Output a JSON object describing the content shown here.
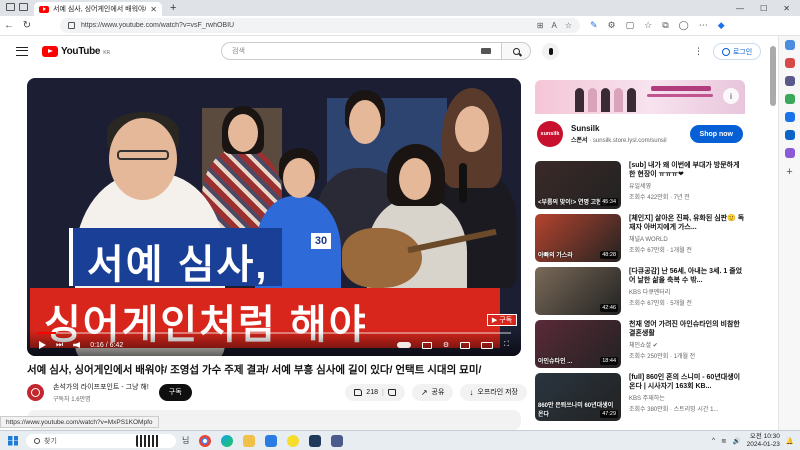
{
  "browser": {
    "tab_title": "서예 심사, 싱어게인에서 배워야/ 조",
    "url": "https://www.youtube.com/watch?v=vsF_rwhOBIU",
    "status_url": "https://www.youtube.com/watch?v=MxPS1KOMpfo"
  },
  "yt": {
    "logo_text": "YouTube",
    "logo_region": "KR",
    "search_placeholder": "검색",
    "login_label": "로그인"
  },
  "video": {
    "caption_line1": "서예 심사,",
    "caption_line2": "싱어게인처럼 해야",
    "badge_label": "구독",
    "time": "0:16 / 6:42",
    "progress_fraction": 0.04,
    "jersey_number": "30"
  },
  "meta": {
    "title": "서예 심사, 싱어게인에서 배워야/ 조영섭 가수 주제 결과/ 서예 부흥 심사에 길이 있다/ 언택트 시대의 묘미/",
    "channel_name": "손석가의 라이프포인트 - 그냥 해!",
    "subscribers": "구독자 1.6만명",
    "subscribe_label": "구독",
    "likes": "218",
    "share_label": "공유",
    "offline_label": "오프라인 저장"
  },
  "ad": {
    "name": "Sunsilk",
    "sponsor": "스폰서",
    "domain": "sunsilk.store.lysl.com/sunsil",
    "cta": "Shop now",
    "logo_text": "sunsilk",
    "info_icon": "i"
  },
  "recs": [
    {
      "title": "[sub] 내가 왜 이번에 부대가 방문하게 한 현장이 ㅠㅠㅠ❤",
      "channel": "유일세영",
      "meta": "조회수 422만회 · 7년 전",
      "duration": "45:34",
      "overlay": "<부름의 맞이!> 연명 고현정",
      "thumb_color": "#3a2a28"
    },
    {
      "title": "[체인지] 살아온 진짜, 유화된 심판🙂 독재자 아버지에게 가스...",
      "channel": "채널A WORLD",
      "meta": "조회수 67만회 · 1개월 전",
      "duration": "48:28",
      "overlay": "아빠의 가스라",
      "thumb_color": "#b5442e"
    },
    {
      "title": "[다큐공감] 난 56세, 아내는 3세. 1 줄었어 날한 삶을 축복 수 밖...",
      "channel": "KBS 다큐멘터리",
      "meta": "조회수 67만회 · 5개월 전",
      "duration": "42:46",
      "overlay": "",
      "thumb_color": "#7a6a58"
    },
    {
      "title": "천재 영어 가려진 아인슈타인의 비참한 결혼생활",
      "channel": "체인쇼셜 ✔",
      "meta": "조회수 250만회 · 1개월 전",
      "duration": "18:44",
      "overlay": "아인슈타인 ...",
      "thumb_color": "#5a2a38"
    },
    {
      "title": "[full] 860인 혼의 스니미 - 60년대생이 온다 | 시사자기 163회 KB...",
      "channel": "KBS 주재하는",
      "meta": "조회수 380만회 · 스트리밍 시간 1...",
      "duration": "47:29",
      "overlay": "860만 은퇴쓰나미 60년대생이 온다",
      "thumb_color": "#2a3540"
    }
  ],
  "taskbar": {
    "search_label": "찾기",
    "widget_label": "님",
    "time": "오전 10:30",
    "date": "2024-01-23"
  }
}
